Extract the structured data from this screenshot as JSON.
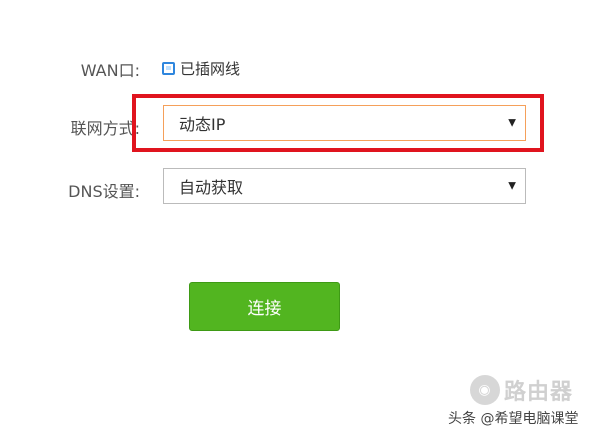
{
  "wan": {
    "label": "WAN口:",
    "status": "已插网线"
  },
  "connection_mode": {
    "label": "联网方式:",
    "value": "动态IP"
  },
  "dns": {
    "label": "DNS设置:",
    "value": "自动获取"
  },
  "connect_button": "连接",
  "watermark": {
    "logo_text": "路由器",
    "credit": "头条 @希望电脑课堂"
  },
  "colors": {
    "accent_green": "#52b520",
    "highlight_red": "#e0141e",
    "port_blue": "#2e86de"
  }
}
